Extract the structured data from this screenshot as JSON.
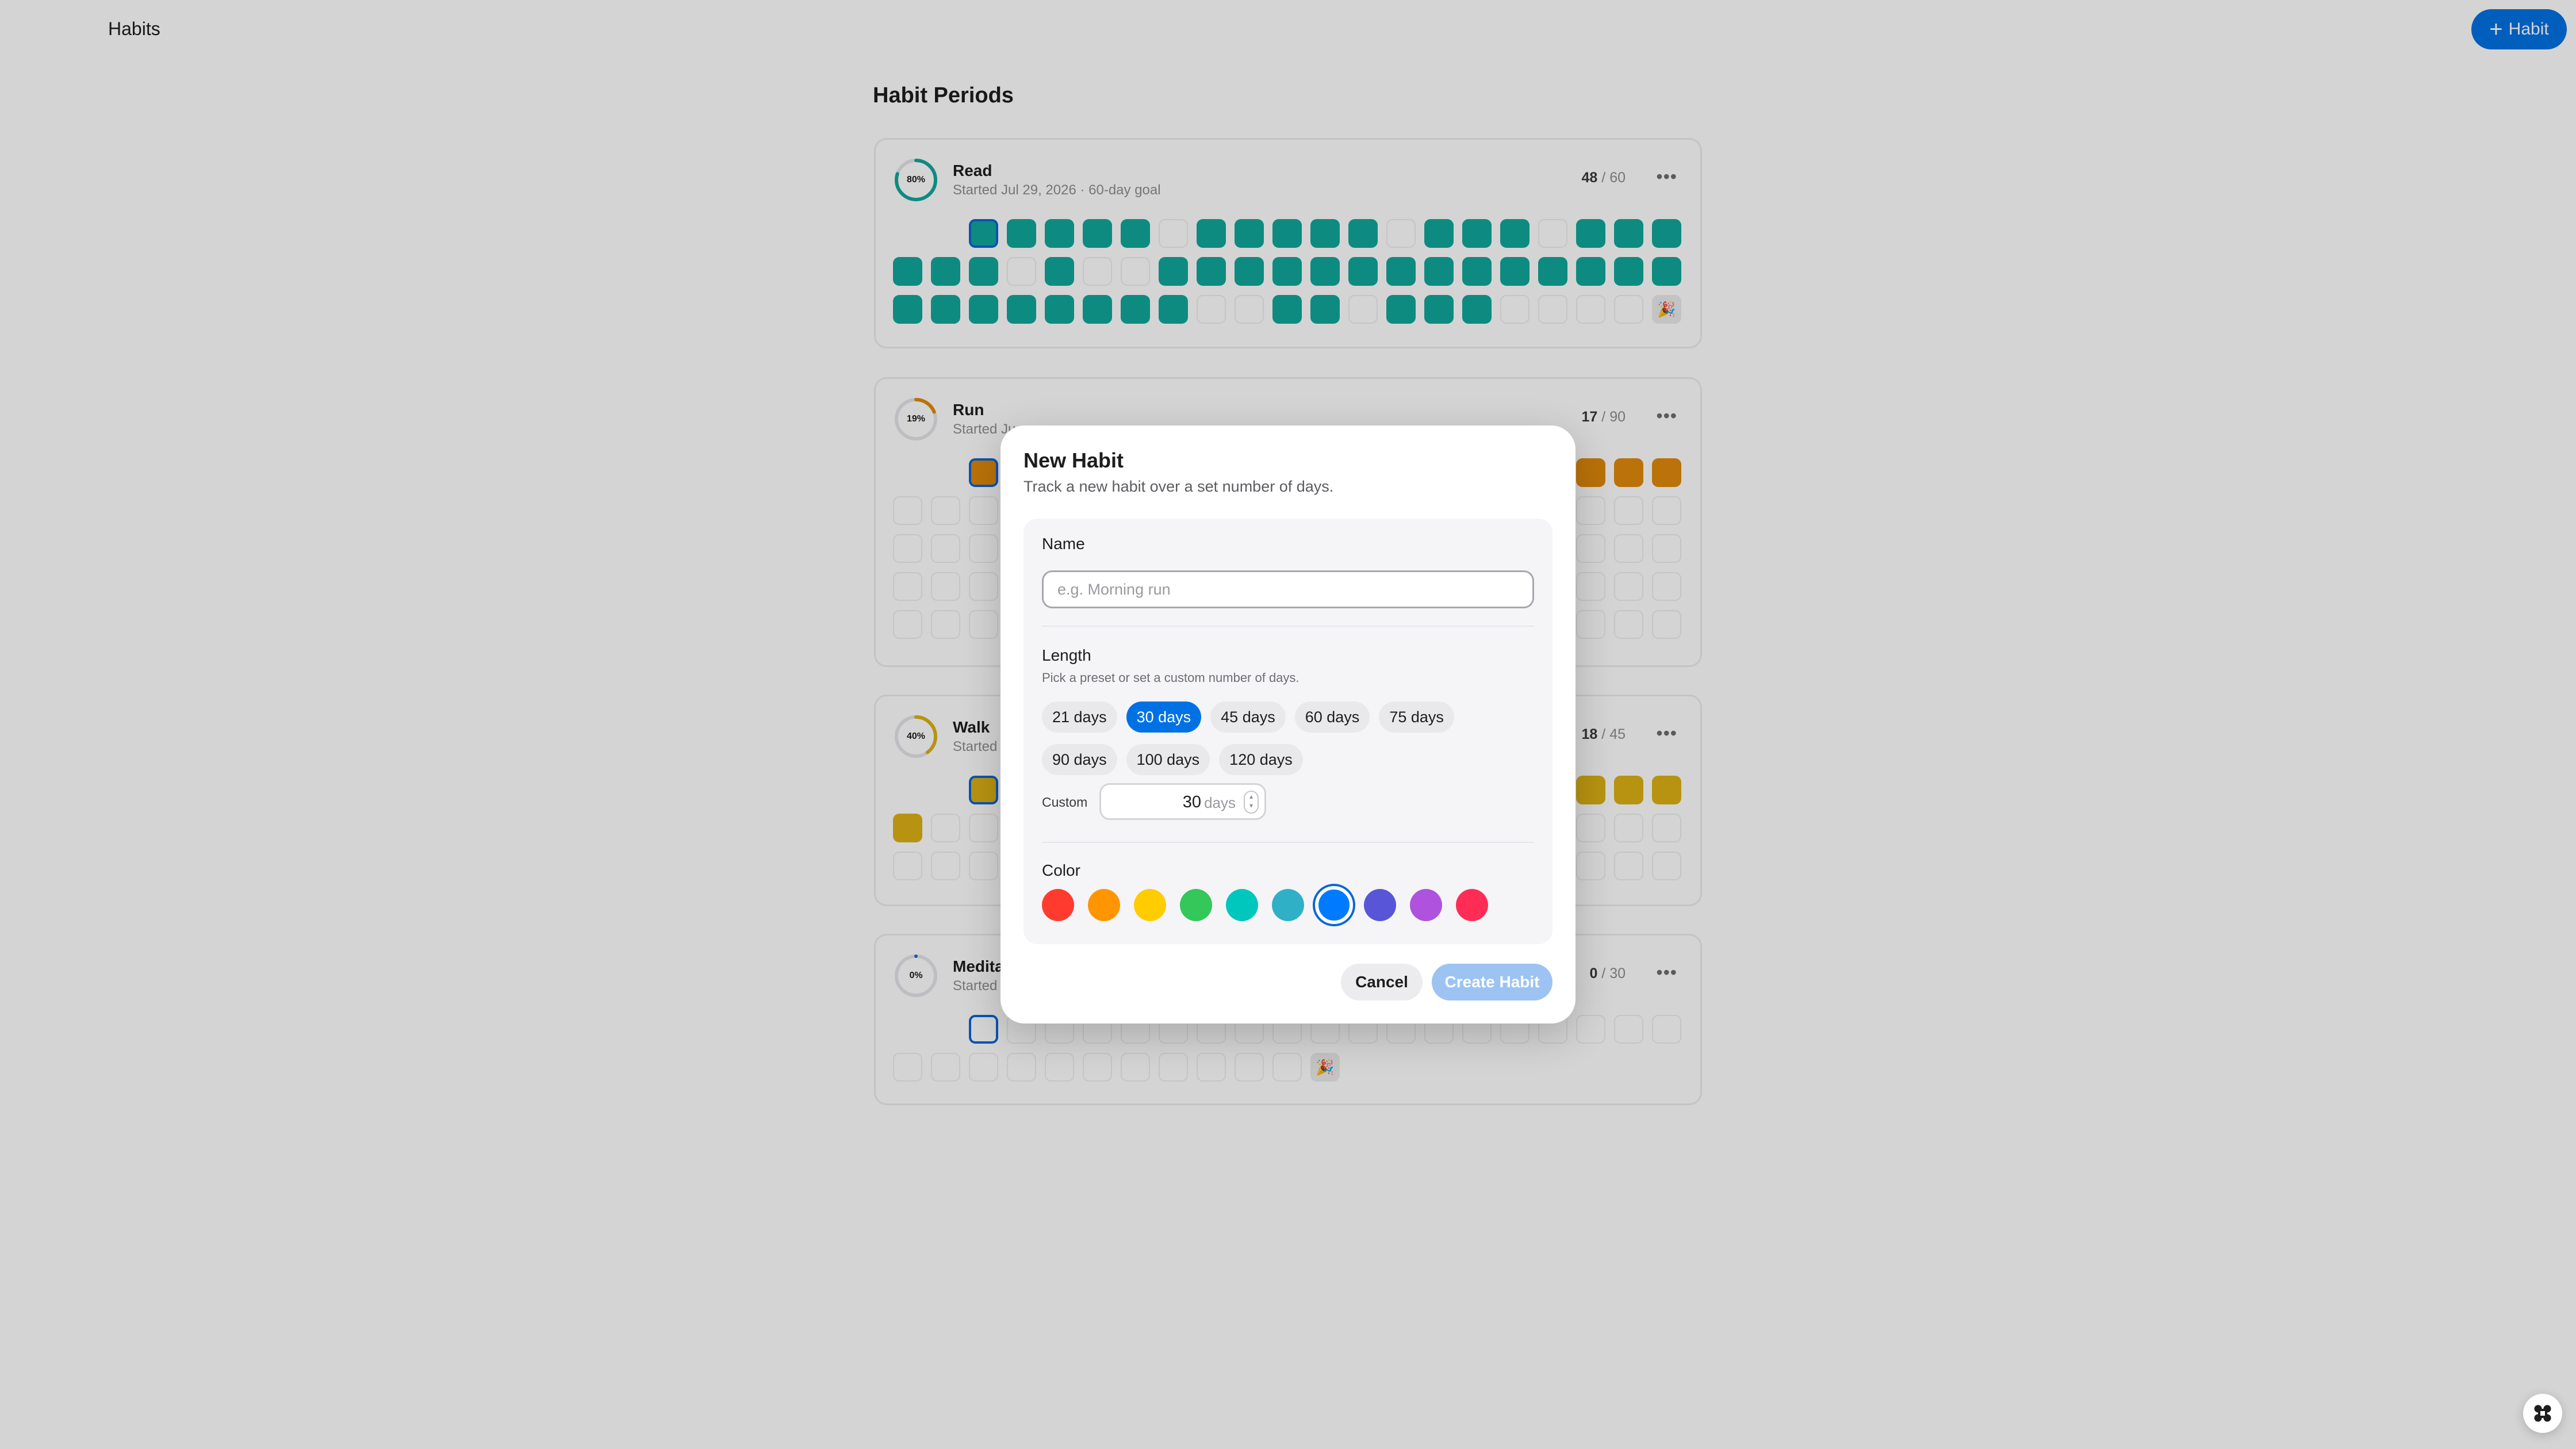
{
  "app": {
    "title": "Habits",
    "add_button": "Habit"
  },
  "section_title": "Habit Periods",
  "accent_color": "#0071e3",
  "habits": [
    {
      "name": "Read",
      "subtitle": "Started Jul 29, 2026 · 60-day goal",
      "percent": "80%",
      "progress": 0.8,
      "done": "48",
      "total": "60",
      "color": "#12a89a",
      "days": [
        1,
        1,
        1,
        1,
        1,
        0,
        1,
        1,
        1,
        1,
        1,
        0,
        1,
        1,
        1,
        0,
        1,
        1,
        1,
        1,
        1,
        1,
        0,
        1,
        0,
        0,
        1,
        1,
        1,
        1,
        1,
        1,
        1,
        1,
        1,
        1,
        1,
        1,
        1,
        1,
        1,
        1,
        1,
        1,
        1,
        1,
        1,
        1,
        0,
        0,
        1,
        1,
        0,
        1,
        1,
        1,
        0,
        0,
        0
      ]
    },
    {
      "name": "Run",
      "subtitle": "Started Ju",
      "percent": "19%",
      "progress": 0.19,
      "done": "17",
      "total": "90",
      "color": "#e08a0b"
    },
    {
      "name": "Walk",
      "subtitle": "Started",
      "percent": "40%",
      "progress": 0.4,
      "done": "18",
      "total": "45",
      "color": "#dcb115"
    },
    {
      "name": "Medita",
      "subtitle": "Started",
      "percent": "0%",
      "progress": 0,
      "done": "0",
      "total": "30",
      "color": "#0071e3"
    }
  ],
  "modal": {
    "title": "New Habit",
    "subtitle": "Track a new habit over a set number of days.",
    "name_label": "Name",
    "name_placeholder": "e.g. Morning run",
    "name_value": "",
    "length_label": "Length",
    "length_hint": "Pick a preset or set a custom number of days.",
    "presets": [
      "21 days",
      "30 days",
      "45 days",
      "60 days",
      "75 days",
      "90 days",
      "100 days",
      "120 days"
    ],
    "selected_preset": "30 days",
    "custom_label": "Custom",
    "custom_value": "30",
    "custom_unit": "days",
    "color_label": "Color",
    "colors": [
      "#ff3b30",
      "#ff9500",
      "#ffcc00",
      "#34c759",
      "#00c7be",
      "#30b0c7",
      "#007aff",
      "#5856d6",
      "#af52de",
      "#ff2d55"
    ],
    "selected_color": "#007aff",
    "cancel": "Cancel",
    "create": "Create Habit"
  }
}
